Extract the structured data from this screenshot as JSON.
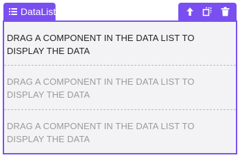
{
  "datalist": {
    "label": "DataList",
    "icon": "list-icon"
  },
  "toolbar": {
    "items": [
      {
        "icon": "select-parent-arrow-icon"
      },
      {
        "icon": "drag-copy-icon"
      },
      {
        "icon": "trash-icon"
      }
    ]
  },
  "items": [
    {
      "text": "DRAG A COMPONENT IN THE DATA LIST TO DISPLAY THE DATA"
    },
    {
      "text": "DRAG A COMPONENT IN THE DATA LIST TO DISPLAY THE DATA"
    },
    {
      "text": "DRAG A COMPONENT IN THE DATA LIST TO DISPLAY THE DATA"
    }
  ],
  "colors": {
    "accent": "#7a4ff0",
    "background": "#f3f3f5",
    "active_text": "#222222",
    "inactive_text": "#9a9a9a"
  }
}
